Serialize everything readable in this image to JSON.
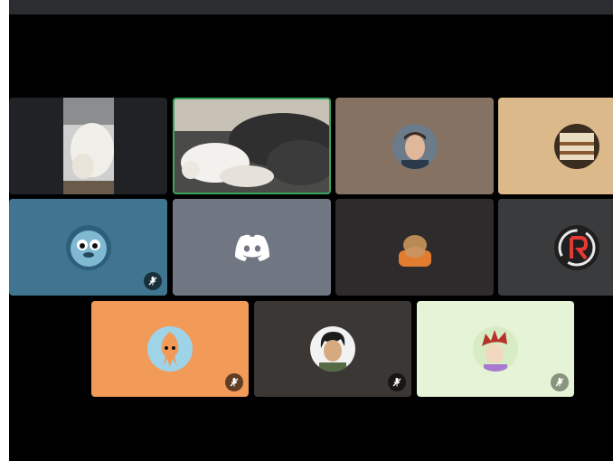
{
  "window": {
    "title": ""
  },
  "colors": {
    "background": "#000000",
    "speaking_border": "#3ba55d",
    "tile_dark": "#202225",
    "tile_brown": "#857262",
    "tile_tan": "#dcb98a",
    "tile_teal": "#3f7590",
    "tile_grey": "#707783",
    "tile_charcoal": "#2d2b2b",
    "tile_darkgrey": "#3a3b3d",
    "tile_orange": "#f29a58",
    "tile_olive": "#3a3734",
    "tile_mint": "#e5f3d6"
  },
  "tiles": [
    {
      "id": "cat-video-1",
      "kind": "video",
      "muted": false,
      "speaking": false
    },
    {
      "id": "cat-video-2",
      "kind": "video",
      "muted": false,
      "speaking": true
    },
    {
      "id": "person-avatar",
      "kind": "avatar",
      "muted": false,
      "speaking": false
    },
    {
      "id": "cake-avatar",
      "kind": "avatar",
      "muted": false,
      "speaking": false
    },
    {
      "id": "fluffball-avatar",
      "kind": "avatar",
      "muted": true,
      "speaking": false
    },
    {
      "id": "discord-default-avatar",
      "kind": "avatar",
      "muted": false,
      "speaking": false
    },
    {
      "id": "potato-avatar",
      "kind": "avatar",
      "muted": false,
      "speaking": false
    },
    {
      "id": "r-logo-avatar",
      "kind": "avatar",
      "muted": false,
      "speaking": false
    },
    {
      "id": "squid-avatar",
      "kind": "avatar",
      "muted": true,
      "speaking": false
    },
    {
      "id": "anime-character-avatar",
      "kind": "avatar",
      "muted": true,
      "speaking": false
    },
    {
      "id": "red-hair-avatar",
      "kind": "avatar",
      "muted": true,
      "speaking": false
    }
  ]
}
